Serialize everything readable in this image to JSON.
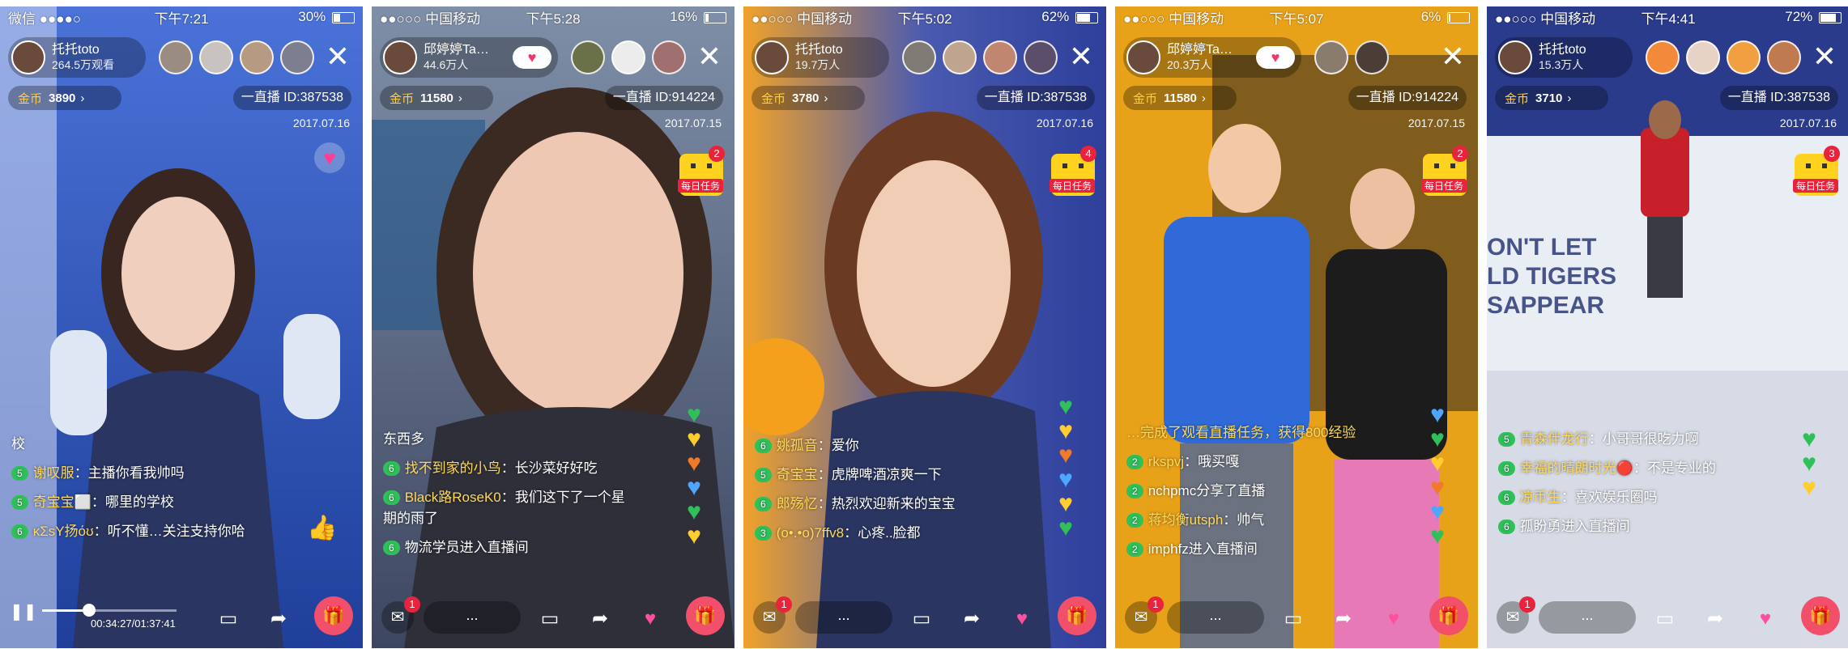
{
  "screens": [
    {
      "status": {
        "carrier": "微信 ●●●●○",
        "time": "下午7:21",
        "battery": "30%",
        "battery_level": 0.3
      },
      "host": {
        "name": "托托toto",
        "fans": "264.5万观看"
      },
      "coins": {
        "label": "金币",
        "value": "3890"
      },
      "live_id": "一直播 ID:387538",
      "date": "2017.07.16",
      "chat": [
        {
          "user": "",
          "text": "校"
        },
        {
          "level": "5",
          "user": "谢叹服",
          "text": "：主播你看我帅吗"
        },
        {
          "level": "5",
          "user": "奇宝宝⬜",
          "text": "：哪里的学校"
        },
        {
          "level": "6",
          "user": "κΣsY扬όʊ",
          "text": "：听不懂…关注支持你哈"
        }
      ],
      "player": {
        "time": "00:34:27/01:37:41",
        "progress": 0.35
      }
    },
    {
      "status": {
        "carrier": "●●○○○ 中国移动",
        "time": "下午5:28",
        "battery": "16%",
        "battery_level": 0.16
      },
      "host": {
        "name": "邱婷婷Ta…",
        "fans": "44.6万人"
      },
      "coins": {
        "label": "金币",
        "value": "11580"
      },
      "live_id": "一直播 ID:914224",
      "date": "2017.07.15",
      "task": {
        "count": "2",
        "label": "每日任务"
      },
      "chat": [
        {
          "user": "",
          "text": "东西多"
        },
        {
          "level": "6",
          "user": "找不到家的小鸟",
          "text": "：长沙菜好好吃"
        },
        {
          "level": "6",
          "user": "Black路RoseK0",
          "text": "：我们这下了一个星期的雨了"
        },
        {
          "level": "6",
          "user": "",
          "text": "物流学员进入直播间"
        }
      ],
      "bottom": {
        "input": "...",
        "msg_count": "1"
      }
    },
    {
      "status": {
        "carrier": "●●○○○ 中国移动",
        "time": "下午5:02",
        "battery": "62%",
        "battery_level": 0.62
      },
      "host": {
        "name": "托托toto",
        "fans": "19.7万人"
      },
      "coins": {
        "label": "金币",
        "value": "3780"
      },
      "live_id": "一直播 ID:387538",
      "date": "2017.07.16",
      "task": {
        "count": "4",
        "label": "每日任务"
      },
      "chat": [
        {
          "level": "6",
          "user": "姚孤音",
          "text": "：爱你"
        },
        {
          "level": "5",
          "user": "奇宝宝",
          "text": "：虎牌啤酒凉爽一下"
        },
        {
          "level": "6",
          "user": "郎殇忆",
          "text": "：热烈欢迎新来的宝宝"
        },
        {
          "level": "3",
          "user": "(o•.•o)7ffv8",
          "text": "：心疼..脸都"
        }
      ],
      "bottom": {
        "input": "...",
        "msg_count": "1"
      }
    },
    {
      "status": {
        "carrier": "●●○○○ 中国移动",
        "time": "下午5:07",
        "battery": "6%",
        "battery_level": 0.06
      },
      "host": {
        "name": "邱婷婷Ta…",
        "fans": "20.3万人"
      },
      "coins": {
        "label": "金币",
        "value": "11580"
      },
      "live_id": "一直播 ID:914224",
      "date": "2017.07.15",
      "task": {
        "count": "2",
        "label": "每日任务"
      },
      "chat": [
        {
          "user": "",
          "text": "…完成了观看直播任务，获得800经验"
        },
        {
          "level": "2",
          "user": "rkspvj",
          "text": "：哦买嘎"
        },
        {
          "level": "2",
          "user": "",
          "text": "nchpmc分享了直播"
        },
        {
          "level": "2",
          "user": "蒋均衡utsph",
          "text": "：帅气"
        },
        {
          "level": "2",
          "user": "",
          "text": "imphfz进入直播间"
        }
      ],
      "bottom": {
        "input": "...",
        "msg_count": "1"
      }
    },
    {
      "status": {
        "carrier": "●●○○○ 中国移动",
        "time": "下午4:41",
        "battery": "72%",
        "battery_level": 0.72
      },
      "host": {
        "name": "托托toto",
        "fans": "15.3万人"
      },
      "coins": {
        "label": "金币",
        "value": "3710"
      },
      "live_id": "一直播 ID:387538",
      "date": "2017.07.16",
      "task": {
        "count": "3",
        "label": "每日任务"
      },
      "scene_text": "ON'T LET\nLD TIGERS\nSAPPEAR",
      "chat": [
        {
          "level": "5",
          "user": "青森伴龙行",
          "text": "：小哥哥很吃力啊"
        },
        {
          "level": "6",
          "user": "幸福的晴朗时光🔴",
          "text": "：不是专业的"
        },
        {
          "level": "6",
          "user": "凉币生",
          "text": "：喜欢娱乐圈吗"
        },
        {
          "level": "6",
          "user": "",
          "text": "孤盼勇进入直播间"
        }
      ],
      "bottom": {
        "input": "...",
        "msg_count": "1"
      }
    }
  ],
  "colors": {
    "accent": "#f2356a",
    "level_badge": "#2fc05a",
    "coin": "#ffcf3f",
    "gift": "#f2506a"
  }
}
